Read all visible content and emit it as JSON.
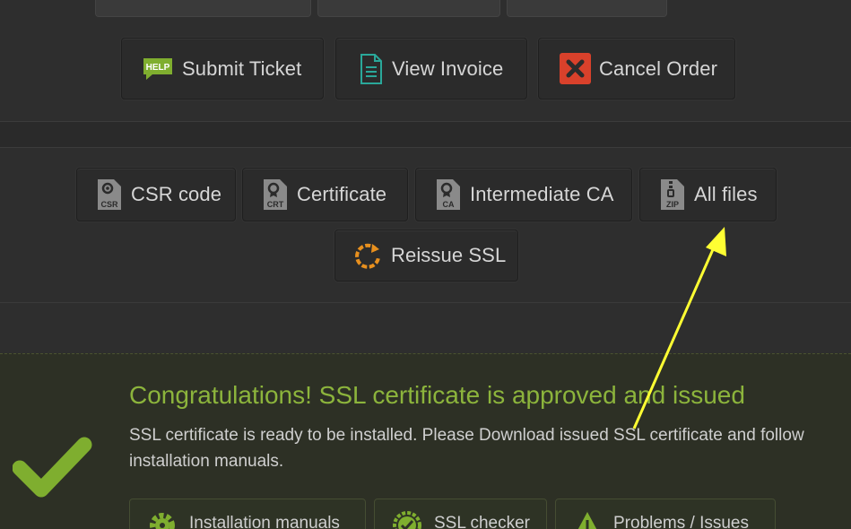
{
  "order_actions": {
    "submit_ticket": "Submit Ticket",
    "view_invoice": "View Invoice",
    "cancel_order": "Cancel Order",
    "help_badge": "HELP"
  },
  "downloads": {
    "csr": "CSR code",
    "csr_badge": "CSR",
    "certificate": "Certificate",
    "crt_badge": "CRT",
    "intermediate": "Intermediate CA",
    "ca_badge": "CA",
    "all_files": "All files",
    "zip_badge": "ZIP",
    "reissue": "Reissue SSL"
  },
  "status": {
    "title": "Congratulations! SSL certificate is approved and issued",
    "message": "SSL certificate is ready to be installed. Please Download issued SSL certificate and follow installation manuals."
  },
  "resources": {
    "manuals": "Installation manuals",
    "checker": "SSL checker",
    "problems": "Problems / Issues"
  },
  "colors": {
    "success_green": "#8cb43c",
    "cancel_red": "#d9412b",
    "invoice_teal": "#2aa89a",
    "reissue_orange": "#e8901e",
    "annotation_yellow": "#ffff33"
  }
}
